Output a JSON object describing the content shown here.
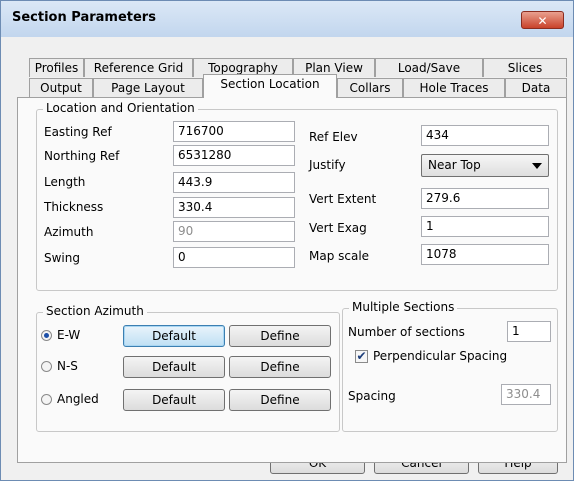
{
  "window": {
    "title": "Section Parameters",
    "close_glyph": "✕"
  },
  "tabs_row1": [
    "Profiles",
    "Reference Grid",
    "Topography",
    "Plan View",
    "Load/Save",
    "Slices"
  ],
  "tabs_row2": [
    "Output",
    "Page Layout",
    "Section Location",
    "Collars",
    "Hole Traces",
    "Data"
  ],
  "location": {
    "group_label": "Location and Orientation",
    "easting_label": "Easting Ref",
    "easting_value": "716700",
    "northing_label": "Northing Ref",
    "northing_value": "6531280",
    "length_label": "Length",
    "length_value": "443.9",
    "thickness_label": "Thickness",
    "thickness_value": "330.4",
    "azimuth_label": "Azimuth",
    "azimuth_value": "90",
    "swing_label": "Swing",
    "swing_value": "0",
    "refelev_label": "Ref Elev",
    "refelev_value": "434",
    "justify_label": "Justify",
    "justify_value": "Near Top",
    "vertextent_label": "Vert Extent",
    "vertextent_value": "279.6",
    "vertexag_label": "Vert Exag",
    "vertexag_value": "1",
    "mapscale_label": "Map scale",
    "mapscale_value": "1078"
  },
  "azimuth": {
    "group_label": "Section Azimuth",
    "selected": "E-W",
    "rows": [
      {
        "label": "E-W",
        "default_label": "Default",
        "define_label": "Define"
      },
      {
        "label": "N-S",
        "default_label": "Default",
        "define_label": "Define"
      },
      {
        "label": "Angled",
        "default_label": "Default",
        "define_label": "Define"
      }
    ]
  },
  "multiple": {
    "group_label": "Multiple Sections",
    "num_label": "Number of sections",
    "num_value": "1",
    "perp_label": "Perpendicular Spacing",
    "perp_checked": true,
    "spacing_label": "Spacing",
    "spacing_value": "330.4"
  },
  "footer": {
    "ok_label": "OK",
    "cancel_label": "Cancel",
    "help_label": "Help"
  }
}
